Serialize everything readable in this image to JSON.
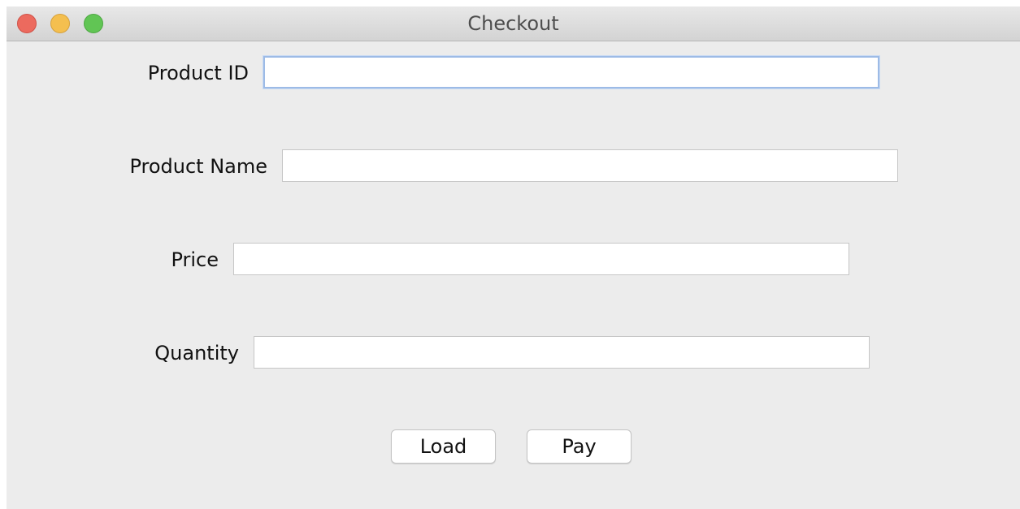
{
  "window": {
    "title": "Checkout",
    "traffic_lights": {
      "close": "#ec6a5e",
      "minimize": "#f4bf4f",
      "zoom": "#61c554"
    }
  },
  "form": {
    "product_id": {
      "label": "Product ID",
      "value": "",
      "focused": true
    },
    "product_name": {
      "label": "Product Name",
      "value": ""
    },
    "price": {
      "label": "Price",
      "value": ""
    },
    "quantity": {
      "label": "Quantity",
      "value": ""
    }
  },
  "buttons": {
    "load": "Load",
    "pay": "Pay"
  },
  "colors": {
    "background": "#ececec",
    "focus_ring": "#9dbbe6"
  }
}
